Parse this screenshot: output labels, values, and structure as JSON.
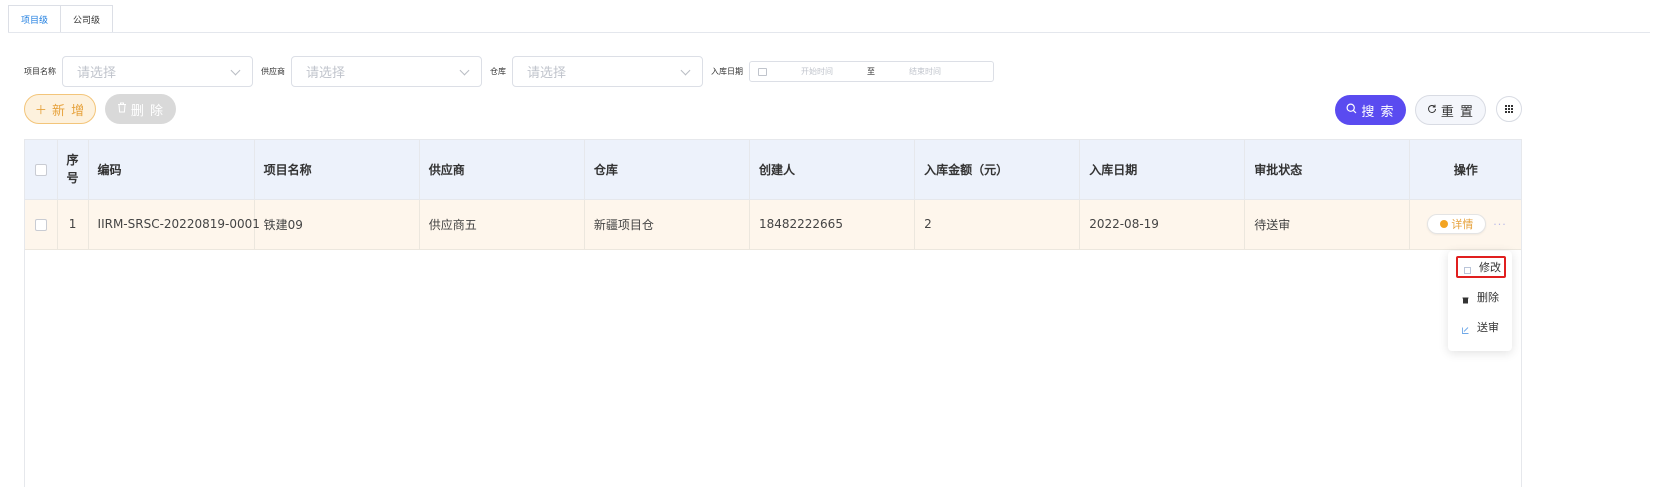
{
  "tabs": [
    {
      "label": "项目级",
      "active": true
    },
    {
      "label": "公司级",
      "active": false
    }
  ],
  "filters": {
    "project_label": "项目名称",
    "project_placeholder": "请选择",
    "supplier_label": "供应商",
    "supplier_placeholder": "请选择",
    "warehouse_label": "仓库",
    "warehouse_placeholder": "请选择",
    "date_label": "入库日期",
    "date_start_placeholder": "开始时间",
    "date_separator": "至",
    "date_end_placeholder": "结束时间"
  },
  "toolbar": {
    "add_label": "新 增",
    "delete_label": "删 除",
    "search_label": "搜 索",
    "reset_label": "重 置"
  },
  "table": {
    "headers": {
      "index": "序号",
      "code": "编码",
      "project": "项目名称",
      "supplier": "供应商",
      "warehouse": "仓库",
      "creator": "创建人",
      "amount": "入库金额（元）",
      "date": "入库日期",
      "status": "审批状态",
      "actions": "操作"
    },
    "rows": [
      {
        "index": "1",
        "code": "IIRM-SRSC-20220819-0001",
        "project": "铁建09",
        "supplier": "供应商五",
        "warehouse": "新疆项目仓",
        "creator": "18482222665",
        "amount": "2",
        "date": "2022-08-19",
        "status": "待送审",
        "detail_label": "详情",
        "more_label": "···"
      }
    ]
  },
  "dropdown": {
    "edit": "修改",
    "delete": "删除",
    "submit": "送审"
  },
  "colors": {
    "primary": "#5a4bf0",
    "warning": "#e6a23c",
    "highlight_border": "#e01f1f",
    "tab_active": "#1f7ee0"
  }
}
